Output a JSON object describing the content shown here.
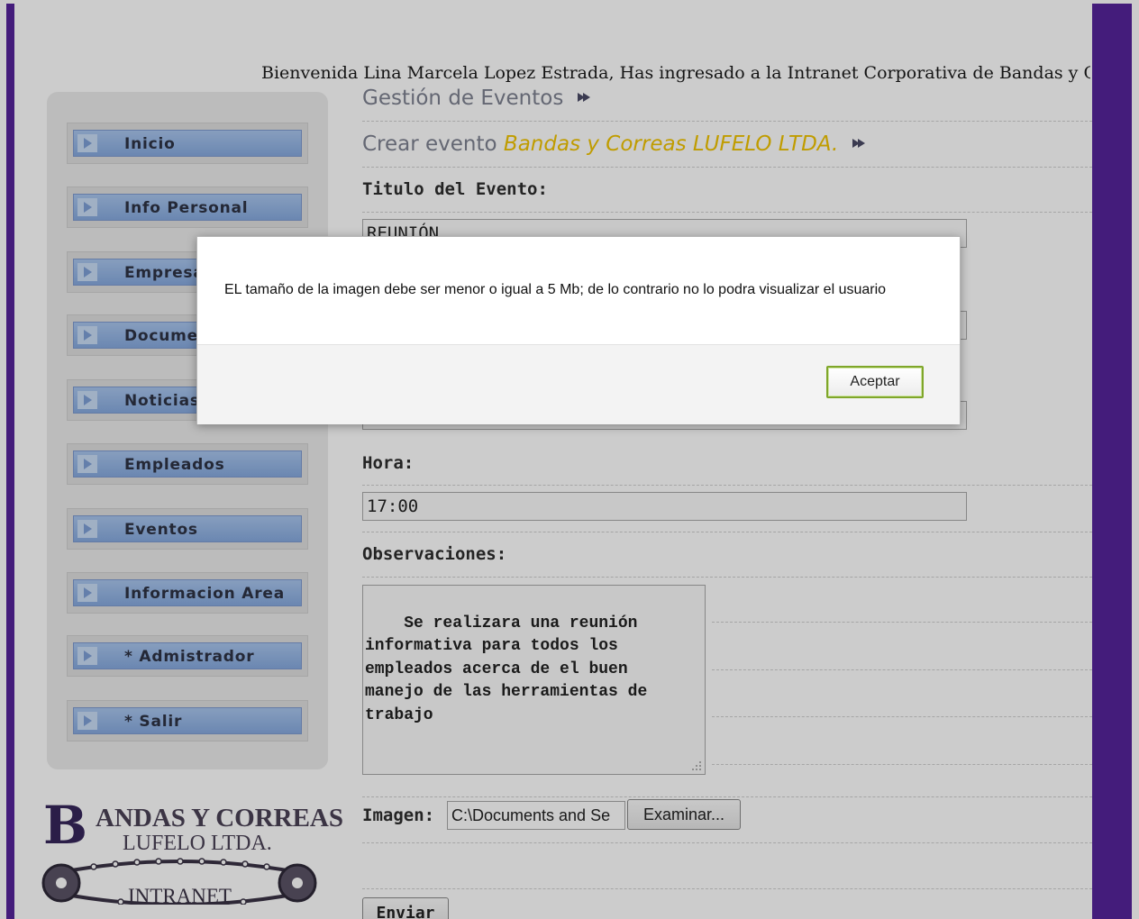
{
  "header": {
    "welcome": "Bienvenida Lina Marcela Lopez Estrada, Has ingresado a la Intranet Corporativa de Bandas y C"
  },
  "sidebar": {
    "items": [
      {
        "label": "Inicio"
      },
      {
        "label": "Info Personal"
      },
      {
        "label": "Empresa"
      },
      {
        "label": "Documentos"
      },
      {
        "label": "Noticias"
      },
      {
        "label": "Empleados"
      },
      {
        "label": "Eventos"
      },
      {
        "label": "Informacion Area"
      },
      {
        "label": "* Admistrador"
      },
      {
        "label": "* Salir"
      }
    ]
  },
  "logo": {
    "big_letter": "B",
    "line1": "ANDAS Y CORREAS",
    "line2": "LUFELO LTDA.",
    "line3": "INTRANET"
  },
  "main": {
    "section_title": "Gestión de Eventos",
    "create_label": "Crear evento",
    "company": "Bandas y Correas LUFELO LTDA.",
    "title_label": "Titulo del Evento:",
    "title_value": "REUNIÓN",
    "time_label": "Hora:",
    "time_value": "17:00",
    "notes_label": "Observaciones:",
    "notes_value": "Se realizara una reunión\ninformativa para todos los\nempleados acerca de el buen\nmanejo de las herramientas de\ntrabajo",
    "image_label": "Imagen:",
    "image_value": "C:\\Documents and Se",
    "browse_label": "Examinar...",
    "submit_label": "Enviar"
  },
  "dialog": {
    "message": "EL tamaño de la imagen debe ser menor o igual a 5 Mb; de lo contrario no lo podra visualizar el usuario",
    "ok_label": "Aceptar"
  },
  "colors": {
    "frame": "#55239a",
    "nav_blue": "#86a9de",
    "company_yellow": "#f0c400",
    "ok_border": "#7fa62a"
  }
}
